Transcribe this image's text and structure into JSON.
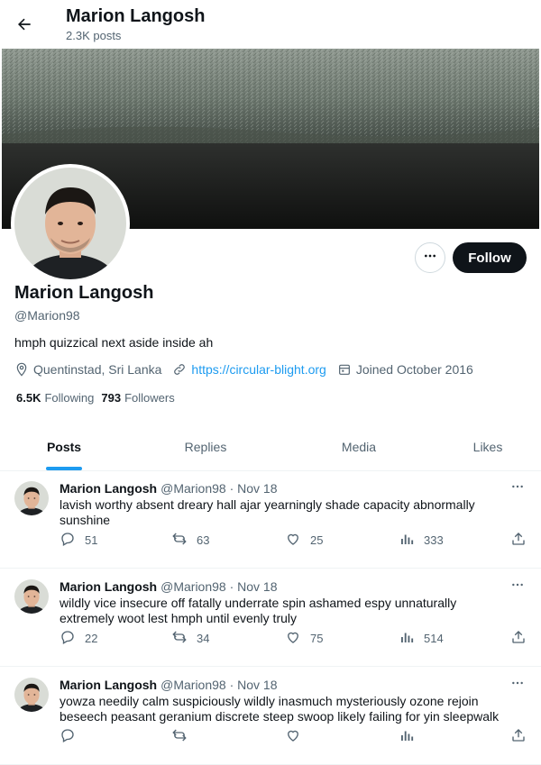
{
  "header": {
    "title": "Marion Langosh",
    "subtitle": "2.3K posts"
  },
  "profile": {
    "name": "Marion Langosh",
    "handle": "@Marion98",
    "bio": "hmph quizzical next aside inside ah",
    "location": "Quentinstad, Sri Lanka",
    "website": "https://circular-blight.org",
    "joined": "Joined October 2016",
    "following_count": "6.5K",
    "following_label": "Following",
    "followers_count": "793",
    "followers_label": "Followers",
    "follow_label": "Follow"
  },
  "tabs": [
    {
      "label": "Posts",
      "active": true
    },
    {
      "label": "Replies",
      "active": false
    },
    {
      "label": "Media",
      "active": false
    },
    {
      "label": "Likes",
      "active": false
    }
  ],
  "posts": [
    {
      "name": "Marion Langosh",
      "handle": "@Marion98",
      "date": "· Nov 18",
      "text": "lavish worthy absent dreary hall ajar yearningly shade capacity abnormally sunshine",
      "replies": "51",
      "reposts": "63",
      "likes": "25",
      "views": "333"
    },
    {
      "name": "Marion Langosh",
      "handle": "@Marion98",
      "date": "· Nov 18",
      "text": "wildly vice insecure off fatally underrate spin ashamed espy unnaturally extremely woot lest hmph until evenly truly",
      "replies": "22",
      "reposts": "34",
      "likes": "75",
      "views": "514"
    },
    {
      "name": "Marion Langosh",
      "handle": "@Marion98",
      "date": "· Nov 18",
      "text": "yowza needily calm suspiciously wildly inasmuch mysteriously ozone rejoin beseech peasant geranium discrete steep swoop likely failing for yin sleepwalk",
      "replies": "",
      "reposts": "",
      "likes": "",
      "views": ""
    }
  ],
  "colors": {
    "accent": "#1d9bf0",
    "text": "#0f1419",
    "muted": "#536471",
    "follow_bg": "#0f1419"
  }
}
